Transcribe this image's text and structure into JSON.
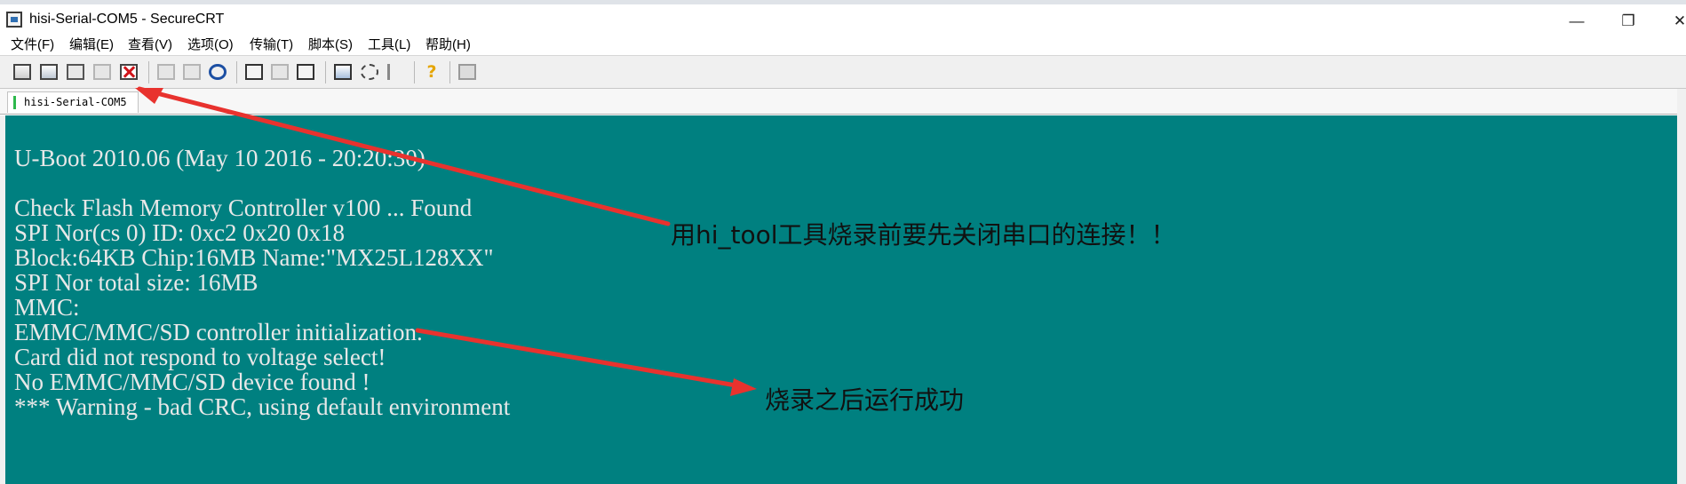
{
  "window": {
    "title": "hisi-Serial-COM5 - SecureCRT",
    "controls": {
      "minimize": "—",
      "maximize": "❐",
      "close": "✕"
    }
  },
  "menu": {
    "items": [
      "文件(F)",
      "编辑(E)",
      "查看(V)",
      "选项(O)",
      "传输(T)",
      "脚本(S)",
      "工具(L)",
      "帮助(H)"
    ]
  },
  "toolbar": {
    "help_glyph": "?"
  },
  "tabs": [
    {
      "label": "hisi-Serial-COM5",
      "active": true,
      "status_color": "#2db84b"
    }
  ],
  "terminal": {
    "background": "#008080",
    "text_color": "#e8e8e8",
    "lines": [
      "U-Boot 2010.06 (May 10 2016 - 20:20:30)",
      "",
      "Check Flash Memory Controller v100 ... Found",
      "SPI Nor(cs 0) ID: 0xc2 0x20 0x18",
      "Block:64KB Chip:16MB Name:\"MX25L128XX\"",
      "SPI Nor total size: 16MB",
      "MMC:",
      "EMMC/MMC/SD controller initialization.",
      "Card did not respond to voltage select!",
      "No EMMC/MMC/SD device found !",
      "*** Warning - bad CRC, using default environment"
    ]
  },
  "annotations": {
    "note1": "用hi_tool工具烧录前要先关闭串口的连接！！",
    "note2": "烧录之后运行成功",
    "arrow_color": "#e8322e"
  }
}
